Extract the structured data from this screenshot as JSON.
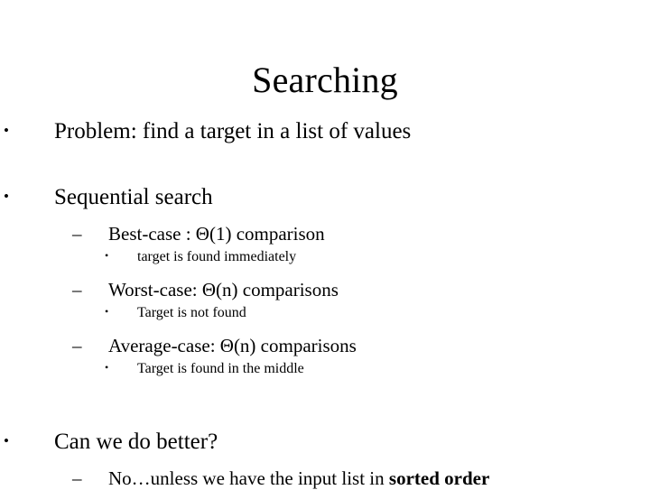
{
  "slide": {
    "title": "Searching",
    "markers": {
      "level1": "•",
      "level2": "–",
      "level3": "•"
    },
    "background_color": "#ffffff",
    "text_color": "#000000",
    "bullets": {
      "problem": "Problem: find a target in a list of values",
      "sequential_search": "Sequential search",
      "best_case": "Best-case : Θ(1) comparison",
      "best_case_detail": "target is found immediately",
      "worst_case": "Worst-case: Θ(n) comparisons",
      "worst_case_detail": "Target is not found",
      "average_case": "Average-case: Θ(n) comparisons",
      "average_case_detail": "Target is found in the middle",
      "can_we_do_better": "Can we do better?",
      "answer_prefix": "No…unless we have the input list in ",
      "answer_emphasis": "sorted order"
    }
  }
}
